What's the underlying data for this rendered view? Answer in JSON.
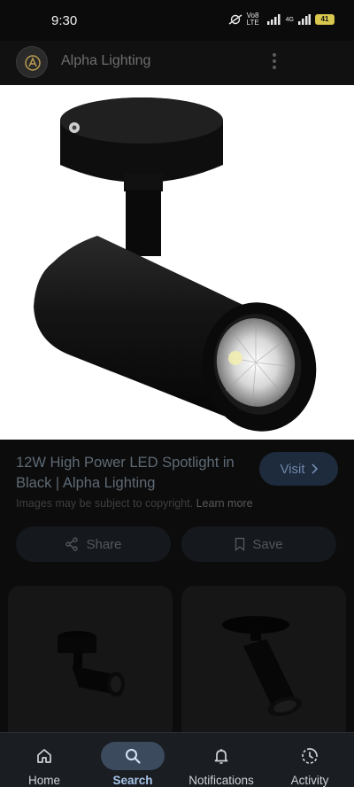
{
  "status_bar": {
    "time": "9:30",
    "network_label": "Vo8 LTE",
    "signal_label": "4G",
    "battery": "41"
  },
  "header": {
    "site_name": "Alpha Lighting"
  },
  "product": {
    "title": "12W High Power LED Spotlight in Black | Alpha Lighting",
    "visit_label": "Visit",
    "copyright_text": "Images may be subject to copyright.",
    "learn_more_label": "Learn more",
    "share_label": "Share",
    "save_label": "Save"
  },
  "bottom_nav": {
    "items": [
      {
        "label": "Home",
        "icon": "home-icon"
      },
      {
        "label": "Search",
        "icon": "search-icon",
        "active": true
      },
      {
        "label": "Notifications",
        "icon": "bell-icon"
      },
      {
        "label": "Activity",
        "icon": "activity-icon"
      }
    ]
  },
  "colors": {
    "accent": "#a8c4ea",
    "visit_button_bg": "#1e2b3d",
    "background": "#0c0c0c"
  }
}
